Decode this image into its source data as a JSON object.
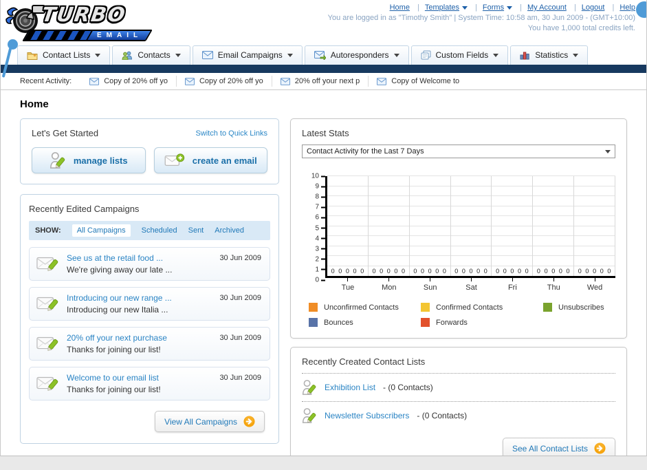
{
  "header": {
    "logo": {
      "title": "TURBO",
      "subtitle": "EMAIL"
    },
    "nav_links": [
      {
        "label": "Home"
      },
      {
        "label": "Templates",
        "dropdown": true
      },
      {
        "label": "Forms",
        "dropdown": true
      },
      {
        "label": "My Account"
      },
      {
        "label": "Logout"
      },
      {
        "label": "Help"
      }
    ],
    "status_line1": "You are logged in as \"Timothy Smith\" | System Time: 10:58 am, 30 Jun 2009 - (GMT+10:00)",
    "status_line2": "You have 1,000 total credits left."
  },
  "nav": {
    "tabs": [
      {
        "label": "Contact Lists"
      },
      {
        "label": "Contacts"
      },
      {
        "label": "Email Campaigns"
      },
      {
        "label": "Autoresponders"
      },
      {
        "label": "Custom Fields"
      },
      {
        "label": "Statistics"
      }
    ]
  },
  "recent_activity": {
    "label": "Recent Activity:",
    "items": [
      {
        "text": "Copy of 20% off yo"
      },
      {
        "text": "Copy of 20% off yo"
      },
      {
        "text": "20% off your next p"
      },
      {
        "text": "Copy of Welcome to"
      }
    ]
  },
  "home": {
    "title": "Home"
  },
  "get_started": {
    "title": "Let's Get Started",
    "switch_link": "Switch to Quick Links",
    "buttons": [
      {
        "label": "manage lists"
      },
      {
        "label": "create an email"
      }
    ]
  },
  "campaigns": {
    "title": "Recently Edited Campaigns",
    "show_label": "SHOW:",
    "filters": [
      {
        "label": "All Campaigns",
        "active": true
      },
      {
        "label": "Scheduled",
        "active": false
      },
      {
        "label": "Sent",
        "active": false
      },
      {
        "label": "Archived",
        "active": false
      }
    ],
    "items": [
      {
        "title": "See us at the retail food ...",
        "subtitle": "We're giving away our late ...",
        "date": "30 Jun 2009"
      },
      {
        "title": "Introducing our new range ...",
        "subtitle": "Introducing our new Italia ...",
        "date": "30 Jun 2009"
      },
      {
        "title": "20% off your next purchase",
        "subtitle": "Thanks for joining our list!",
        "date": "30 Jun 2009"
      },
      {
        "title": "Welcome to our email list",
        "subtitle": "Thanks for joining our list!",
        "date": "30 Jun 2009"
      }
    ],
    "view_all_label": "View All Campaigns"
  },
  "latest_stats": {
    "title": "Latest Stats",
    "dropdown_value": "Contact Activity for the Last 7 Days"
  },
  "chart_data": {
    "type": "bar",
    "title": "Contact Activity for the Last 7 Days",
    "categories": [
      "Tue",
      "Mon",
      "Sun",
      "Sat",
      "Fri",
      "Thu",
      "Wed"
    ],
    "series": [
      {
        "name": "Unconfirmed Contacts",
        "color": "#f08d26",
        "values": [
          0,
          0,
          0,
          0,
          0,
          0,
          0
        ]
      },
      {
        "name": "Confirmed Contacts",
        "color": "#f3c532",
        "values": [
          0,
          0,
          0,
          0,
          0,
          0,
          0
        ]
      },
      {
        "name": "Unsubscribes",
        "color": "#7aa32e",
        "values": [
          0,
          0,
          0,
          0,
          0,
          0,
          0
        ]
      },
      {
        "name": "Bounces",
        "color": "#5873a8",
        "values": [
          0,
          0,
          0,
          0,
          0,
          0,
          0
        ]
      },
      {
        "name": "Forwards",
        "color": "#e2512b",
        "values": [
          0,
          0,
          0,
          0,
          0,
          0,
          0
        ]
      }
    ],
    "xlabel": "",
    "ylabel": "",
    "ylim": [
      0,
      10
    ],
    "ytick_step": 1,
    "grid": true,
    "legend_position": "bottom",
    "value_labels_shown": true
  },
  "contact_lists": {
    "title": "Recently Created Contact Lists",
    "items": [
      {
        "name": "Exhibition List",
        "suffix": "- (0 Contacts)"
      },
      {
        "name": "Newsletter Subscribers",
        "suffix": "- (0 Contacts)"
      }
    ],
    "see_all_label": "See All Contact Lists"
  }
}
